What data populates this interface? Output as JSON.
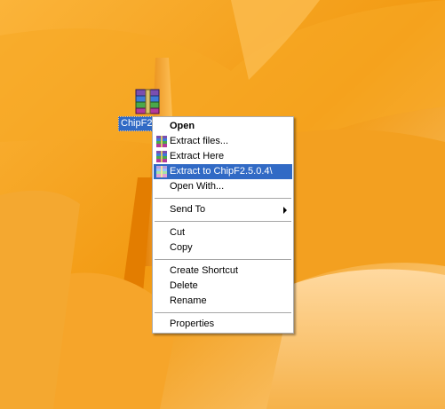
{
  "desktop": {
    "icon_label": "ChipF2.",
    "icon_name": "winrar-archive-icon"
  },
  "menu": {
    "open": "Open",
    "extract_files": "Extract files...",
    "extract_here": "Extract Here",
    "extract_to": "Extract to ChipF2.5.0.4\\",
    "open_with": "Open With...",
    "send_to": "Send To",
    "cut": "Cut",
    "copy": "Copy",
    "create_shortcut": "Create Shortcut",
    "delete": "Delete",
    "rename": "Rename",
    "properties": "Properties"
  },
  "colors": {
    "highlight": "#316ac5",
    "wallpaper": "#f19a14"
  }
}
